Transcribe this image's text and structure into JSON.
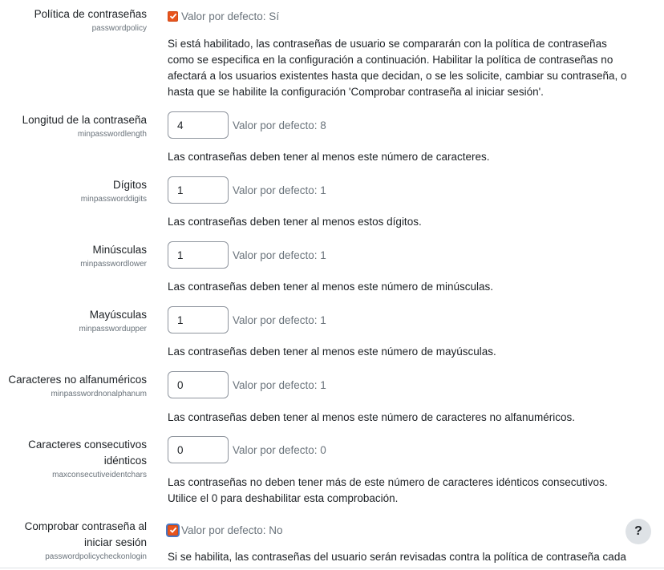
{
  "settings": {
    "passwordpolicy": {
      "title": "Política de contraseñas",
      "key": "passwordpolicy",
      "checked": true,
      "default": "Valor por defecto: Sí",
      "description": "Si está habilitado, las contraseñas de usuario se compararán con la política de contraseñas como se especifica en la configuración a continuación. Habilitar la política de contraseñas no afectará a los usuarios existentes hasta que decidan, o se les solicite, cambiar su contraseña, o hasta que se habilite la configuración 'Comprobar contraseña al iniciar sesión'."
    },
    "minpasswordlength": {
      "title": "Longitud de la contraseña",
      "key": "minpasswordlength",
      "value": "4",
      "default": "Valor por defecto: 8",
      "description": "Las contraseñas deben tener al menos este número de caracteres."
    },
    "minpassworddigits": {
      "title": "Dígitos",
      "key": "minpassworddigits",
      "value": "1",
      "default": "Valor por defecto: 1",
      "description": "Las contraseñas deben tener al menos estos dígitos."
    },
    "minpasswordlower": {
      "title": "Minúsculas",
      "key": "minpasswordlower",
      "value": "1",
      "default": "Valor por defecto: 1",
      "description": "Las contraseñas deben tener al menos este número de minúsculas."
    },
    "minpasswordupper": {
      "title": "Mayúsculas",
      "key": "minpasswordupper",
      "value": "1",
      "default": "Valor por defecto: 1",
      "description": "Las contraseñas deben tener al menos este número de mayúsculas."
    },
    "minpasswordnonalphanum": {
      "title": "Caracteres no alfanuméricos",
      "key": "minpasswordnonalphanum",
      "value": "0",
      "default": "Valor por defecto: 1",
      "description": "Las contraseñas deben tener al menos este número de caracteres no alfanuméricos."
    },
    "maxconsecutiveidentchars": {
      "title_line1": "Caracteres consecutivos",
      "title_line2": "idénticos",
      "key": "maxconsecutiveidentchars",
      "value": "0",
      "default": "Valor por defecto: 0",
      "description_line1": "Las contraseñas no deben tener más de este número de caracteres idénticos consecutivos.",
      "description_line2": "Utilice el 0 para deshabilitar esta comprobación."
    },
    "passwordpolicycheckonlogin": {
      "title_line1": "Comprobar contraseña al",
      "title_line2": "iniciar sesión",
      "key": "passwordpolicycheckonlogin",
      "checked": true,
      "default": "Valor por defecto: No",
      "description": "Si se habilita, las contraseñas del usuario serán revisadas contra la política de contraseña cada"
    }
  },
  "help": {
    "label": "?",
    "icon": "question-mark-icon"
  },
  "colors": {
    "checkbox": "#e8541d",
    "muted": "#6a737b",
    "text": "#1d2125",
    "input_border": "#8f959e"
  }
}
